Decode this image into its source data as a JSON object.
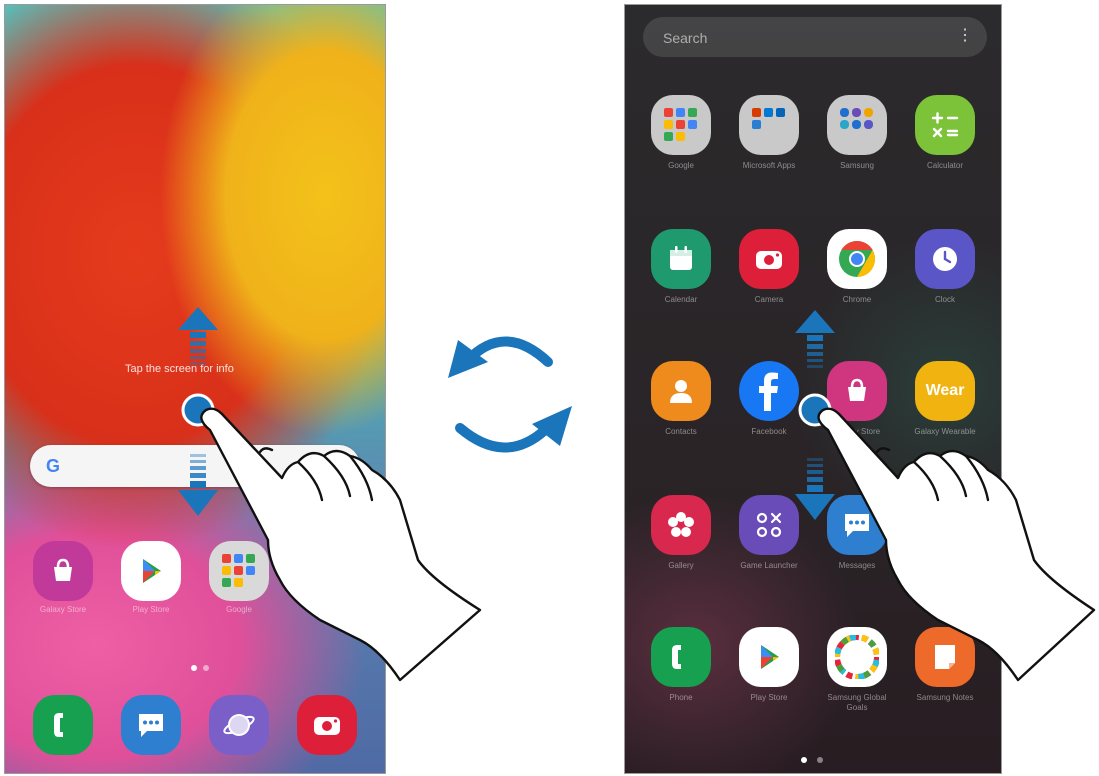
{
  "home_screen": {
    "hint_text": "Tap the screen for info",
    "google_bar": {
      "letter": "G"
    },
    "apps": [
      {
        "name": "Galaxy Store",
        "color": "#c13a9a"
      },
      {
        "name": "Play Store",
        "color": "#ffffff"
      },
      {
        "name": "Google",
        "color": "#d9d9d9"
      },
      {
        "name": "",
        "color": "#4f6aa5"
      }
    ],
    "dock": [
      {
        "name": "Phone",
        "color": "#17a050"
      },
      {
        "name": "Messages",
        "color": "#2f7fd1"
      },
      {
        "name": "Internet",
        "color": "#7b5fc8"
      },
      {
        "name": "Camera",
        "color": "#dd1f3a"
      }
    ]
  },
  "apps_screen": {
    "search_placeholder": "Search",
    "more_icon": "⋮",
    "apps": [
      {
        "name": "Google",
        "color": "#c9c9c9"
      },
      {
        "name": "Microsoft Apps",
        "color": "#c9c9c9"
      },
      {
        "name": "Samsung",
        "color": "#c9c9c9"
      },
      {
        "name": "Calculator",
        "color": "#7cc33a"
      },
      {
        "name": "Calendar",
        "color": "#1f9a6f"
      },
      {
        "name": "Camera",
        "color": "#dd1f3a"
      },
      {
        "name": "Chrome",
        "color": "#ffffff"
      },
      {
        "name": "Clock",
        "color": "#5a56c8"
      },
      {
        "name": "Contacts",
        "color": "#ef8a1c"
      },
      {
        "name": "Facebook",
        "color": "#1877f2"
      },
      {
        "name": "Galaxy Store",
        "color": "#d0357f"
      },
      {
        "name": "Galaxy Wearable",
        "color": "#f0b30f"
      },
      {
        "name": "Gallery",
        "color": "#d9284d"
      },
      {
        "name": "Game Launcher",
        "color": "#6a4cb8"
      },
      {
        "name": "Messages",
        "color": "#2f7fd1"
      },
      {
        "name": "",
        "color": "#2a2427"
      },
      {
        "name": "Phone",
        "color": "#17a050"
      },
      {
        "name": "Play Store",
        "color": "#ffffff"
      },
      {
        "name": "Samsung Global Goals",
        "color": "#ffffff"
      },
      {
        "name": "Samsung Notes",
        "color": "#ee6a2a"
      }
    ],
    "icon_text": {
      "wear": "Wear"
    }
  },
  "colors": {
    "arrow_blue": "#1b75bb",
    "touch_dot": "#1b75bb"
  }
}
